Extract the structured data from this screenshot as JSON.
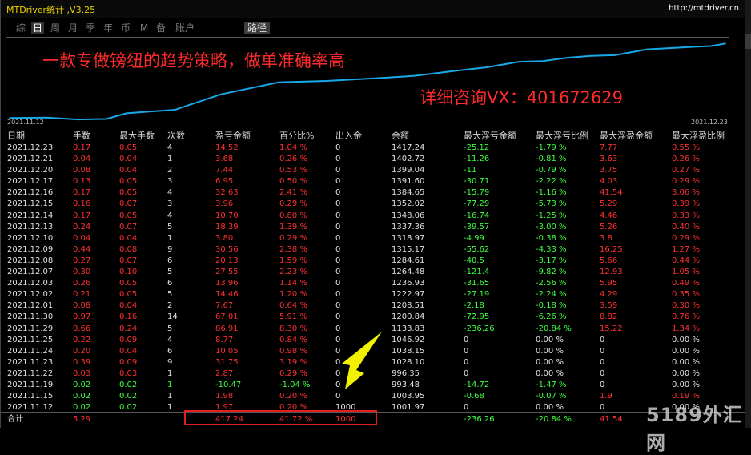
{
  "window": {
    "title": "MTDriver统计 ,V3.25",
    "url": "http://mtdriver.cn"
  },
  "period_tabs": [
    {
      "label": "综",
      "active": false
    },
    {
      "label": "日",
      "active": true
    },
    {
      "label": "周",
      "active": false
    },
    {
      "label": "月",
      "active": false
    },
    {
      "label": "季",
      "active": false
    },
    {
      "label": "年",
      "active": false
    },
    {
      "label": "币",
      "active": false
    },
    {
      "label": "M",
      "active": false
    },
    {
      "label": "备",
      "active": false
    },
    {
      "label": "账户",
      "active": false
    }
  ],
  "route_label": "路径",
  "promo": {
    "line1": "一款专做镑纽的趋势策略，做单准确率高",
    "line2": "详细咨询VX：401672629"
  },
  "chart_data": {
    "type": "line",
    "x_start_label": "2021.11.12",
    "x_end_label": "2021.12.23",
    "line_color": "#19a8e8",
    "x": [
      "2021.11.12",
      "2021.11.15",
      "2021.11.19",
      "2021.11.22",
      "2021.11.23",
      "2021.11.24",
      "2021.11.25",
      "2021.11.29",
      "2021.11.30",
      "2021.12.01",
      "2021.12.02",
      "2021.12.03",
      "2021.12.07",
      "2021.12.08",
      "2021.12.09",
      "2021.12.10",
      "2021.12.13",
      "2021.12.14",
      "2021.12.15",
      "2021.12.16",
      "2021.12.17",
      "2021.12.20",
      "2021.12.21",
      "2021.12.23"
    ],
    "values": [
      1001.97,
      1003.95,
      993.48,
      996.35,
      1028.1,
      1038.15,
      1046.92,
      1133.83,
      1200.84,
      1208.51,
      1222.97,
      1236.93,
      1264.48,
      1284.61,
      1315.17,
      1318.97,
      1337.36,
      1348.06,
      1352.02,
      1384.65,
      1391.6,
      1399.04,
      1402.72,
      1417.24
    ]
  },
  "table": {
    "headers": [
      "日期",
      "手数",
      "最大手数",
      "次数",
      "盈亏金额",
      "百分比%",
      "出入金",
      "余额",
      "最大浮亏金额",
      "最大浮亏比例",
      "最大浮盈金额",
      "最大浮盈比例"
    ],
    "rows": [
      [
        "2021.12.23",
        "0.17",
        "0.05",
        "4",
        "14.52",
        "1.04 %",
        "0",
        "1417.24",
        "-25.12",
        "-1.79 %",
        "7.77",
        "0.55 %"
      ],
      [
        "2021.12.21",
        "0.04",
        "0.04",
        "1",
        "3.68",
        "0.26 %",
        "0",
        "1402.72",
        "-11.26",
        "-0.81 %",
        "3.63",
        "0.26 %"
      ],
      [
        "2021.12.20",
        "0.08",
        "0.04",
        "2",
        "7.44",
        "0.53 %",
        "0",
        "1399.04",
        "-11",
        "-0.79 %",
        "3.75",
        "0.27 %"
      ],
      [
        "2021.12.17",
        "0.13",
        "0.05",
        "3",
        "6.95",
        "0.50 %",
        "0",
        "1391.60",
        "-30.71",
        "-2.22 %",
        "4.03",
        "0.29 %"
      ],
      [
        "2021.12.16",
        "0.17",
        "0.05",
        "4",
        "32.63",
        "2.41 %",
        "0",
        "1384.65",
        "-15.79",
        "-1.16 %",
        "41.54",
        "3.06 %"
      ],
      [
        "2021.12.15",
        "0.16",
        "0.07",
        "3",
        "3.96",
        "0.29 %",
        "0",
        "1352.02",
        "-77.29",
        "-5.73 %",
        "5.29",
        "0.39 %"
      ],
      [
        "2021.12.14",
        "0.17",
        "0.05",
        "4",
        "10.70",
        "0.80 %",
        "0",
        "1348.06",
        "-16.74",
        "-1.25 %",
        "4.46",
        "0.33 %"
      ],
      [
        "2021.12.13",
        "0.24",
        "0.07",
        "5",
        "18.39",
        "1.39 %",
        "0",
        "1337.36",
        "-39.57",
        "-3.00 %",
        "5.26",
        "0.40 %"
      ],
      [
        "2021.12.10",
        "0.04",
        "0.04",
        "1",
        "3.80",
        "0.29 %",
        "0",
        "1318.97",
        "-4.99",
        "-0.38 %",
        "3.8",
        "0.29 %"
      ],
      [
        "2021.12.09",
        "0.44",
        "0.08",
        "9",
        "30.56",
        "2.38 %",
        "0",
        "1315.17",
        "-55.62",
        "-4.33 %",
        "16.25",
        "1.27 %"
      ],
      [
        "2021.12.08",
        "0.27",
        "0.07",
        "6",
        "20.13",
        "1.59 %",
        "0",
        "1284.61",
        "-40.5",
        "-3.17 %",
        "5.66",
        "0.44 %"
      ],
      [
        "2021.12.07",
        "0.30",
        "0.10",
        "5",
        "27.55",
        "2.23 %",
        "0",
        "1264.48",
        "-121.4",
        "-9.82 %",
        "12.93",
        "1.05 %"
      ],
      [
        "2021.12.03",
        "0.26",
        "0.05",
        "6",
        "13.96",
        "1.14 %",
        "0",
        "1236.93",
        "-31.65",
        "-2.56 %",
        "5.95",
        "0.49 %"
      ],
      [
        "2021.12.02",
        "0.21",
        "0.05",
        "5",
        "14.46",
        "1.20 %",
        "0",
        "1222.97",
        "-27.19",
        "-2.24 %",
        "4.29",
        "0.35 %"
      ],
      [
        "2021.12.01",
        "0.08",
        "0.04",
        "2",
        "7.67",
        "0.64 %",
        "0",
        "1208.51",
        "-2.18",
        "-0.18 %",
        "3.59",
        "0.30 %"
      ],
      [
        "2021.11.30",
        "0.97",
        "0.16",
        "14",
        "67.01",
        "5.91 %",
        "0",
        "1200.84",
        "-72.95",
        "-6.26 %",
        "8.82",
        "0.76 %"
      ],
      [
        "2021.11.29",
        "0.66",
        "0.24",
        "5",
        "86.91",
        "8.30 %",
        "0",
        "1133.83",
        "-236.26",
        "-20.84 %",
        "15.22",
        "1.34 %"
      ],
      [
        "2021.11.25",
        "0.22",
        "0.09",
        "4",
        "8.77",
        "0.84 %",
        "0",
        "1046.92",
        "0",
        "0.00 %",
        "0",
        "0.00 %"
      ],
      [
        "2021.11.24",
        "0.20",
        "0.04",
        "6",
        "10.05",
        "0.98 %",
        "0",
        "1038.15",
        "0",
        "0.00 %",
        "0",
        "0.00 %"
      ],
      [
        "2021.11.23",
        "0.39",
        "0.09",
        "9",
        "31.75",
        "3.19 %",
        "0",
        "1028.10",
        "0",
        "0.00 %",
        "0",
        "0.00 %"
      ],
      [
        "2021.11.22",
        "0.03",
        "0.03",
        "1",
        "2.87",
        "0.29 %",
        "0",
        "996.35",
        "0",
        "0.00 %",
        "0",
        "0.00 %"
      ],
      [
        "2021.11.19",
        "0.02",
        "0.02",
        "1",
        "-10.47",
        "-1.04 %",
        "0",
        "993.48",
        "-14.72",
        "-1.47 %",
        "0",
        "0.00 %"
      ],
      [
        "2021.11.15",
        "0.02",
        "0.02",
        "1",
        "1.98",
        "0.20 %",
        "0",
        "1003.95",
        "-0.68",
        "-0.07 %",
        "1.9",
        "0.19 %"
      ],
      [
        "2021.11.12",
        "0.02",
        "0.02",
        "1",
        "1.97",
        "0.20 %",
        "1000",
        "1001.97",
        "0",
        "0.00 %",
        "0",
        "0.00 %"
      ]
    ],
    "totals": [
      "合计",
      "5.29",
      "",
      "",
      "417.24",
      "41.72 %",
      "1000",
      "",
      "-236.26",
      "-20.84 %",
      "41.54",
      ""
    ]
  },
  "watermark": "5189外汇网",
  "colors": {
    "title": "#e8d000",
    "positive": "#ff3030",
    "negative": "#40ff40",
    "line": "#19a8e8",
    "highlight_box": "#e02020",
    "arrow": "#f2f200"
  }
}
